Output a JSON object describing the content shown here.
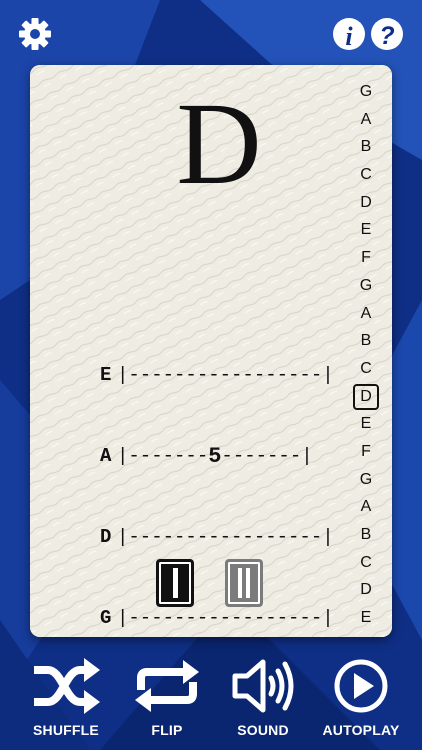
{
  "colors": {
    "background": "#0f2f86",
    "card": "#efede3",
    "ink": "#111111",
    "icon": "#ffffff",
    "inactive_position": "#7b7b7b"
  },
  "toolbar": {
    "settings_icon": "gear-icon",
    "info_icon": "info-icon",
    "help_icon": "help-icon"
  },
  "card": {
    "note": "D",
    "tab": [
      {
        "string": "E",
        "line": "|-----------------|",
        "fret": ""
      },
      {
        "string": "A",
        "line_left": "|-------",
        "fret": "5",
        "line_right": "-------|"
      },
      {
        "string": "D",
        "line": "|-----------------|",
        "fret": ""
      },
      {
        "string": "G",
        "line": "|-----------------|",
        "fret": ""
      }
    ],
    "scale": [
      "G",
      "A",
      "B",
      "C",
      "D",
      "E",
      "F",
      "G",
      "A",
      "B",
      "C",
      "D",
      "E",
      "F",
      "G",
      "A",
      "B",
      "C",
      "D",
      "E"
    ],
    "selected_scale_index": 11,
    "positions": [
      {
        "label": "I",
        "active": true
      },
      {
        "label": "II",
        "active": false
      }
    ]
  },
  "bottom_bar": [
    {
      "label": "SHUFFLE",
      "icon": "shuffle-icon"
    },
    {
      "label": "FLIP",
      "icon": "repeat-icon"
    },
    {
      "label": "SOUND",
      "icon": "speaker-icon"
    },
    {
      "label": "AUTOPLAY",
      "icon": "play-icon"
    }
  ]
}
